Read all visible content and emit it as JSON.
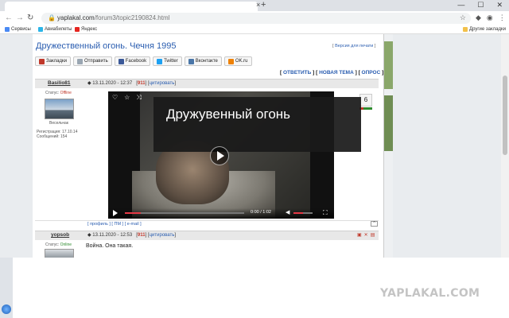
{
  "browser": {
    "url_host": "yaplakal.com",
    "url_path": "/forum3/topic2190824.html",
    "nav_back": "←",
    "nav_forward": "→",
    "reload": "↻",
    "home": "⌂",
    "lock": "🔒",
    "star": "☆",
    "new_tab": "+",
    "tab_close": "×",
    "win_min": "—",
    "win_max": "☐",
    "win_close": "✕",
    "tb_icon_1": "◆",
    "tb_icon_2": "◉",
    "tb_icon_3": "⋮"
  },
  "bookmarks": {
    "apps": "Сервисы",
    "avia": "Авиабилеты",
    "yandex": "Яндекс",
    "other": "Другие закладки"
  },
  "topic": {
    "title": "Дружественный огонь. Чечня 1995",
    "print_link": "Версия для печати",
    "reply": "ОТВЕТИТЬ",
    "new_topic": "НОВАЯ ТЕМА",
    "poll": "ОПРОС"
  },
  "share": {
    "bookmarks": "Закладки",
    "send": "Отправить",
    "facebook": "Facebook",
    "twitter": "Twitter",
    "vk": "Вконтакте",
    "ok": "OK.ru"
  },
  "post1": {
    "author": "Basilio81",
    "date": "13.11.2020 - 12:37",
    "rating": "911",
    "quote": "цитировать",
    "status_label": "Статус:",
    "status_value": "Offline",
    "nick_label": "Весельчак",
    "registration": "Регистрация: 17.10.14",
    "messages": "Сообщений: 154",
    "vote": "6",
    "footer_profile": "профиль",
    "footer_pm": "ПМ",
    "footer_email": "e-mail",
    "up": "^"
  },
  "video": {
    "title": "Дружувенный огонь",
    "time": "0:00 / 1:02",
    "heart": "♡",
    "star": "☆",
    "share": "⤨",
    "volume": "◀",
    "fullscreen": "⛶"
  },
  "post2": {
    "author": "yopsob",
    "date": "13.11.2020 - 12:53",
    "rating": "911",
    "quote": "цитировать",
    "status_label": "Статус:",
    "status_value": "Online",
    "message": "Война. Она такая."
  },
  "watermark": "YAPLAKAL.COM"
}
